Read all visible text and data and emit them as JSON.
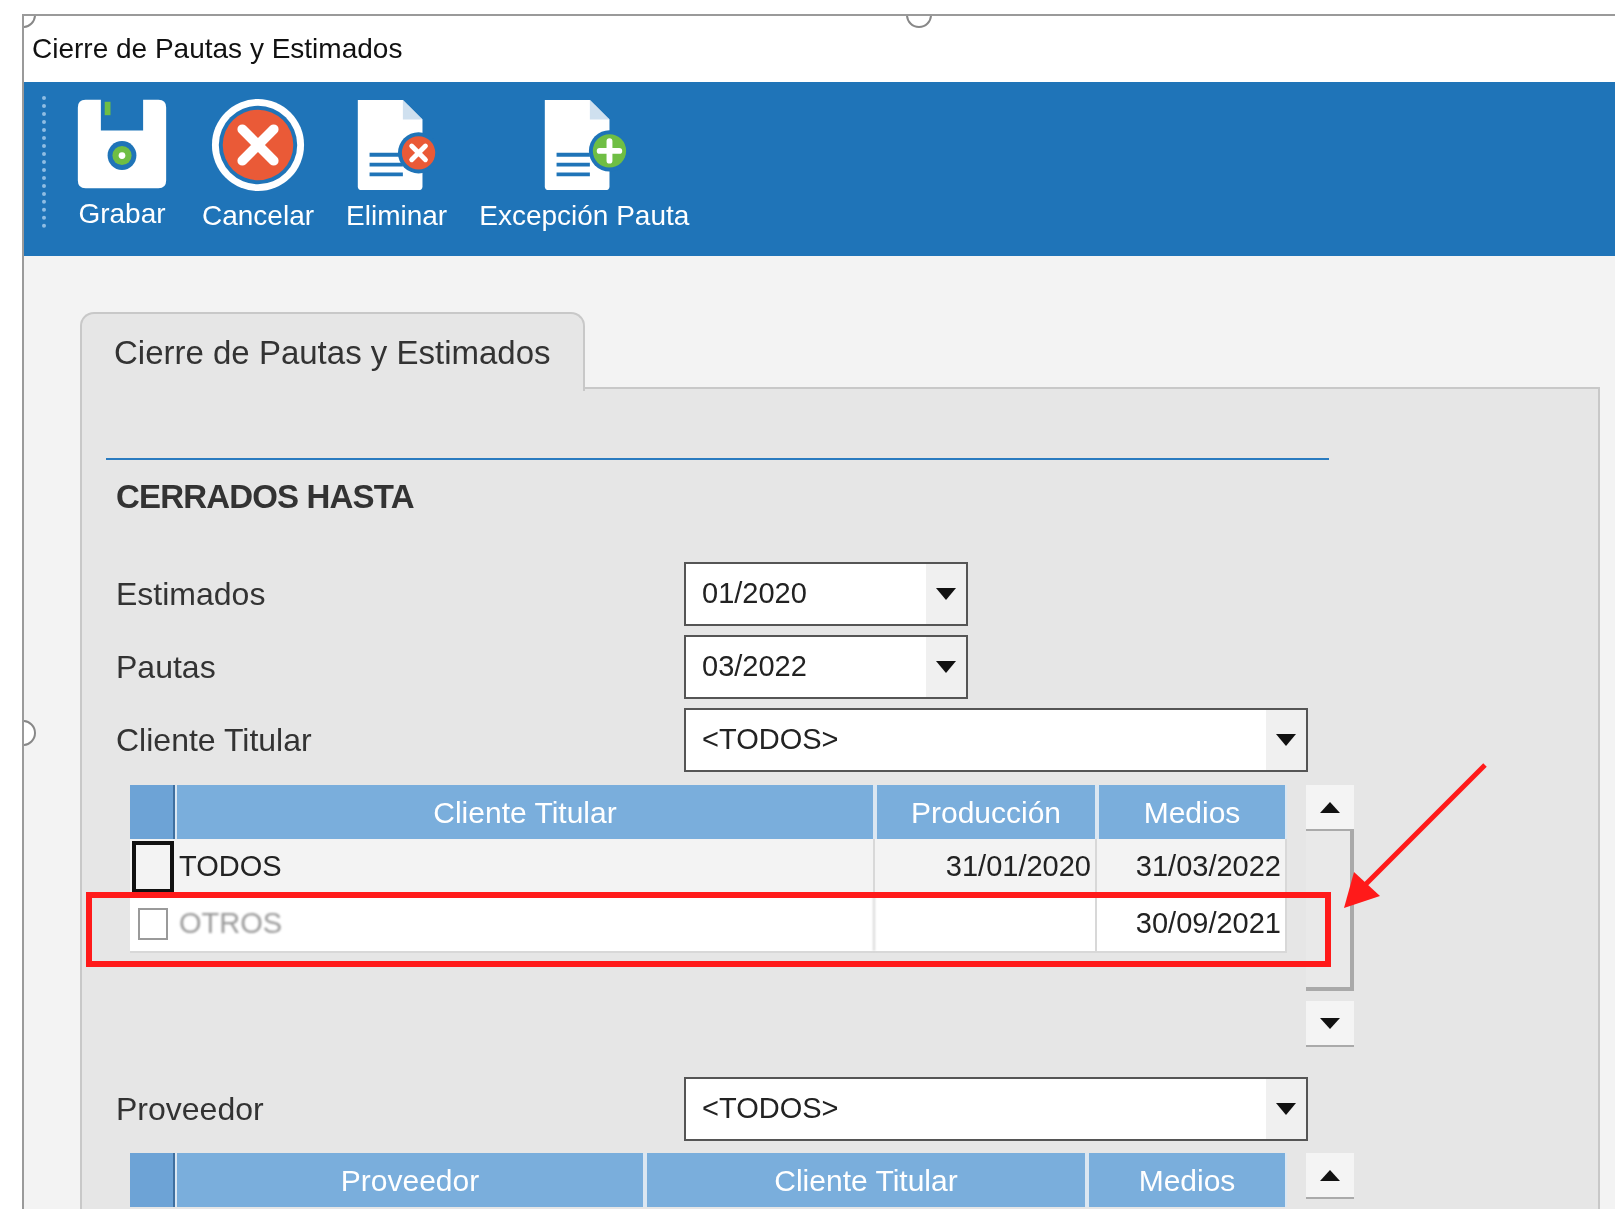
{
  "window": {
    "title": "Cierre de Pautas y Estimados"
  },
  "toolbar": [
    {
      "kind": "save",
      "label": "Grabar"
    },
    {
      "kind": "cancel",
      "label": "Cancelar"
    },
    {
      "kind": "delete",
      "label": "Eliminar"
    },
    {
      "kind": "add",
      "label": "Excepción Pauta"
    }
  ],
  "tabs": [
    {
      "label": "Cierre de Pautas y Estimados",
      "selected": true
    }
  ],
  "section": {
    "title": "CERRADOS HASTA"
  },
  "fields": [
    {
      "label": "Estimados",
      "value": "01/2020",
      "kind": "short"
    },
    {
      "label": "Pautas",
      "value": "03/2022",
      "kind": "short"
    },
    {
      "label": "Cliente Titular",
      "value": "<TODOS>",
      "kind": "wide"
    }
  ],
  "clientes_table": {
    "columns": [
      "Cliente Titular",
      "Producción",
      "Medios"
    ],
    "rows": [
      {
        "cells": [
          "TODOS",
          "31/01/2020",
          "31/03/2022"
        ],
        "focused": true,
        "dimmed": false
      },
      {
        "cells": [
          "OTROS",
          "",
          "30/09/2021"
        ],
        "focused": false,
        "dimmed": true
      }
    ]
  },
  "proveedor_field": {
    "label": "Proveedor",
    "value": "<TODOS>"
  },
  "proveedores_table": {
    "columns": [
      "Proveedor",
      "Cliente Titular",
      "Medios"
    ]
  },
  "highlight_box": {
    "color": "#ff1a1a"
  },
  "pointer_arrow": {
    "color": "#ff1a1a"
  }
}
